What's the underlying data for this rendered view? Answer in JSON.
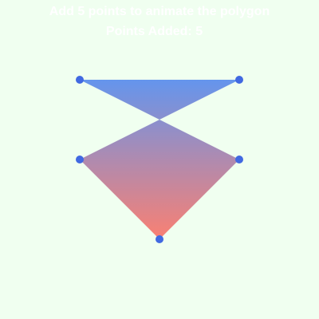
{
  "instruction": "Add 5 points to animate the polygon",
  "counter": {
    "label": "Points Added:",
    "value": 5
  },
  "colors": {
    "background": "#f0fff0",
    "text": "#ffffff",
    "point": "#4169e1",
    "gradient_top": "#6495ed",
    "gradient_bottom": "#fa8072"
  }
}
